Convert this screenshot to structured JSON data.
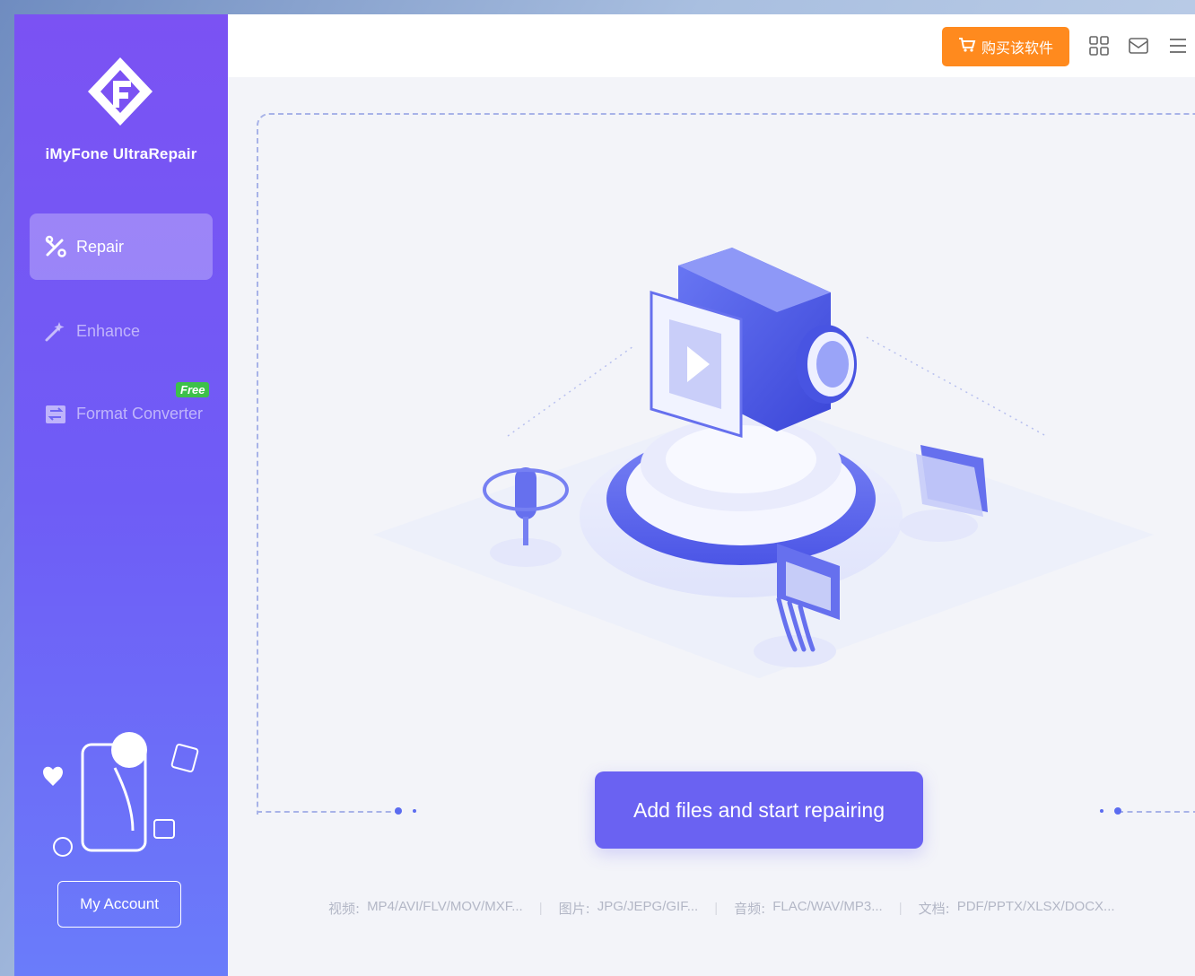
{
  "app": {
    "name": "iMyFone UltraRepair"
  },
  "sidebar": {
    "items": [
      {
        "label": "Repair",
        "icon": "tools-icon",
        "active": true
      },
      {
        "label": "Enhance",
        "icon": "magic-wand-icon",
        "active": false
      },
      {
        "label": "Format Converter",
        "icon": "convert-icon",
        "active": false,
        "badge": "Free"
      }
    ],
    "account_button": "My Account"
  },
  "topbar": {
    "buy_label": "购买该软件",
    "icons": [
      "grid-icon",
      "mail-icon",
      "menu-icon"
    ]
  },
  "main": {
    "cta_label": "Add files and start repairing",
    "formats": [
      {
        "key": "视频:",
        "value": "MP4/AVI/FLV/MOV/MXF..."
      },
      {
        "key": "图片:",
        "value": "JPG/JEPG/GIF..."
      },
      {
        "key": "音频:",
        "value": "FLAC/WAV/MP3..."
      },
      {
        "key": "文档:",
        "value": "PDF/PPTX/XLSX/DOCX..."
      }
    ]
  },
  "colors": {
    "sidebar_top": "#7b52f3",
    "sidebar_bottom": "#6a7cfa",
    "accent": "#6a62f2",
    "buy_button": "#ff8a1e",
    "free_badge": "#3dc14a"
  }
}
